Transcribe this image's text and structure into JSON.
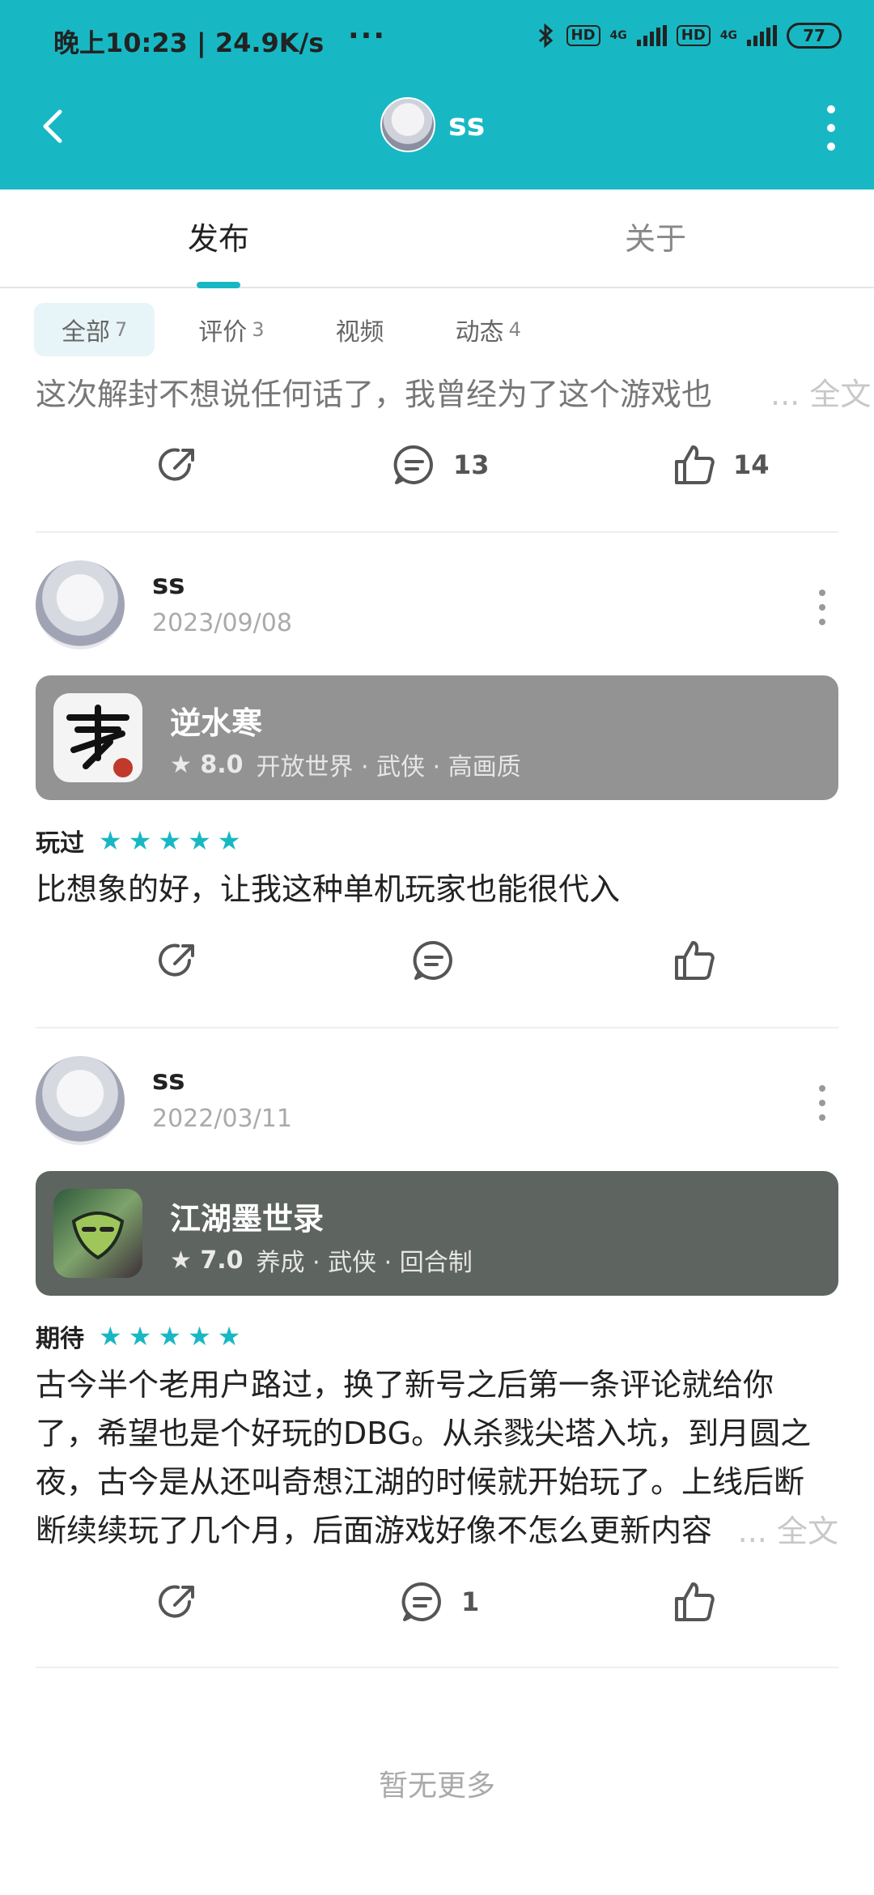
{
  "status_bar": {
    "time_speed": "晚上10:23 | 24.9K/s",
    "more": "···",
    "hd1": "HD",
    "net1": "4G",
    "hd2": "HD",
    "net2": "4G",
    "battery": "77"
  },
  "header": {
    "title": "ss"
  },
  "tabs": {
    "publish": "发布",
    "about": "关于"
  },
  "filters": [
    {
      "label": "全部",
      "count": "7"
    },
    {
      "label": "评价",
      "count": "3"
    },
    {
      "label": "视频",
      "count": ""
    },
    {
      "label": "动态",
      "count": "4"
    }
  ],
  "top_post": {
    "preview": "这次解封不想说任何话了，我曾经为了这个游戏也",
    "ellipsis": "...",
    "full_link": "全文",
    "comments": "13",
    "likes": "14"
  },
  "posts": [
    {
      "user": "ss",
      "date": "2023/09/08",
      "game_name": "逆水寒",
      "score": "8.0",
      "tags": "开放世界 · 武侠 · 高画质",
      "status": "玩过",
      "stars": 5,
      "text": "比想象的好，让我这种单机玩家也能很代入",
      "comments": "",
      "likes": ""
    },
    {
      "user": "ss",
      "date": "2022/03/11",
      "game_name": "江湖墨世录",
      "score": "7.0",
      "tags": "养成 · 武侠 · 回合制",
      "status": "期待",
      "stars": 5,
      "text_lines": [
        "古今半个老用户路过，换了新号之后第一条评论就给你",
        "了，希望也是个好玩的DBG。从杀戮尖塔入坑，到月圆之",
        "夜，古今是从还叫奇想江湖的时候就开始玩了。上线后断",
        "断续续玩了几个月，后面游戏好像不怎么更新内容"
      ],
      "ellipsis": "...",
      "full_link": "全文",
      "comments": "1",
      "likes": ""
    }
  ],
  "footer": "暂无更多",
  "colors": {
    "accent": "#17b8c3",
    "card1": "#939393",
    "card2": "#5e6460"
  }
}
